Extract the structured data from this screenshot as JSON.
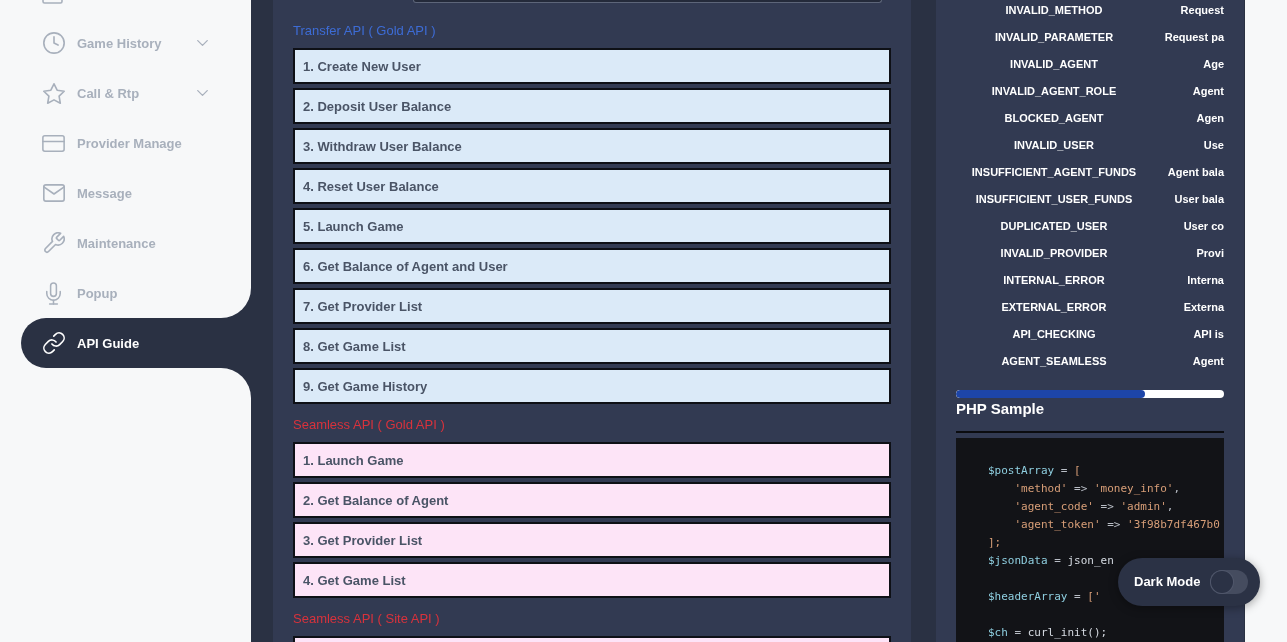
{
  "sidebar": {
    "cut_off_item_above": true,
    "items": [
      {
        "label": "Game History",
        "has_submenu": true,
        "selected": false
      },
      {
        "label": "Call & Rtp",
        "has_submenu": true,
        "selected": false
      },
      {
        "label": "Provider Manage",
        "has_submenu": false,
        "selected": false
      },
      {
        "label": "Message",
        "has_submenu": false,
        "selected": false
      },
      {
        "label": "Maintenance",
        "has_submenu": false,
        "selected": false
      },
      {
        "label": "Popup",
        "has_submenu": false,
        "selected": false
      },
      {
        "label": "API Guide",
        "has_submenu": false,
        "selected": true
      }
    ]
  },
  "api_list": {
    "cut_off_field_above": true,
    "sections": [
      {
        "title": "Transfer API ( Gold API )",
        "kind": "transfer",
        "items": [
          "1. Create New User",
          "2. Deposit User Balance",
          "3. Withdraw User Balance",
          "4. Reset User Balance",
          "5. Launch Game",
          "6. Get Balance of Agent and User",
          "7. Get Provider List",
          "8. Get Game List",
          "9. Get Game History"
        ]
      },
      {
        "title": "Seamless API ( Gold API )",
        "kind": "seamless",
        "items": [
          "1. Launch Game",
          "2. Get Balance of Agent",
          "3. Get Provider List",
          "4. Get Game List"
        ]
      },
      {
        "title": "Seamless API ( Site API )",
        "kind": "seamless",
        "cut_off_item_below": true
      }
    ]
  },
  "error_codes": {
    "rows": [
      {
        "code": "INVALID_METHOD",
        "description": "Request"
      },
      {
        "code": "INVALID_PARAMETER",
        "description": "Request pa"
      },
      {
        "code": "INVALID_AGENT",
        "description": "Age"
      },
      {
        "code": "INVALID_AGENT_ROLE",
        "description": "Agent"
      },
      {
        "code": "BLOCKED_AGENT",
        "description": "Agen"
      },
      {
        "code": "INVALID_USER",
        "description": "Use"
      },
      {
        "code": "INSUFFICIENT_AGENT_FUNDS",
        "description": "Agent bala"
      },
      {
        "code": "INSUFFICIENT_USER_FUNDS",
        "description": "User bala"
      },
      {
        "code": "DUPLICATED_USER",
        "description": "User co"
      },
      {
        "code": "INVALID_PROVIDER",
        "description": "Provi"
      },
      {
        "code": "INTERNAL_ERROR",
        "description": "Interna"
      },
      {
        "code": "EXTERNAL_ERROR",
        "description": "Externa"
      },
      {
        "code": "API_CHECKING",
        "description": "API is"
      },
      {
        "code": "AGENT_SEAMLESS",
        "description": "Agent"
      }
    ]
  },
  "php_sample": {
    "title": "PHP Sample",
    "lines": [
      {
        "kind": "code",
        "tokens": [
          {
            "kind": "var",
            "text": "$postArray"
          },
          {
            "kind": "op",
            "text": " = "
          },
          {
            "kind": "punct",
            "text": "["
          }
        ]
      },
      {
        "kind": "code",
        "tokens": [
          {
            "kind": "str",
            "text": "    'method'"
          },
          {
            "kind": "op",
            "text": " => "
          },
          {
            "kind": "str",
            "text": "'money_info'"
          },
          {
            "kind": "op",
            "text": ","
          }
        ]
      },
      {
        "kind": "code",
        "tokens": [
          {
            "kind": "str",
            "text": "    'agent_code'"
          },
          {
            "kind": "op",
            "text": " => "
          },
          {
            "kind": "str",
            "text": "'admin'"
          },
          {
            "kind": "op",
            "text": ","
          }
        ]
      },
      {
        "kind": "code",
        "tokens": [
          {
            "kind": "str",
            "text": "    'agent_token'"
          },
          {
            "kind": "op",
            "text": " => "
          },
          {
            "kind": "str",
            "text": "'3f98b7df467b0"
          }
        ]
      },
      {
        "kind": "code",
        "tokens": [
          {
            "kind": "punct",
            "text": "];"
          }
        ]
      },
      {
        "kind": "code",
        "tokens": [
          {
            "kind": "var",
            "text": "$jsonData"
          },
          {
            "kind": "op",
            "text": " = "
          },
          {
            "kind": "fn",
            "text": "json_en"
          }
        ]
      },
      {
        "kind": "blank"
      },
      {
        "kind": "code",
        "tokens": [
          {
            "kind": "var",
            "text": "$headerArray"
          },
          {
            "kind": "op",
            "text": " = "
          },
          {
            "kind": "punct",
            "text": "['"
          }
        ]
      },
      {
        "kind": "blank"
      },
      {
        "kind": "code",
        "tokens": [
          {
            "kind": "var",
            "text": "$ch"
          },
          {
            "kind": "op",
            "text": " = "
          },
          {
            "kind": "fn",
            "text": "curl_init();"
          }
        ]
      }
    ]
  },
  "dark_mode": {
    "label": "Dark Mode",
    "on": false
  }
}
